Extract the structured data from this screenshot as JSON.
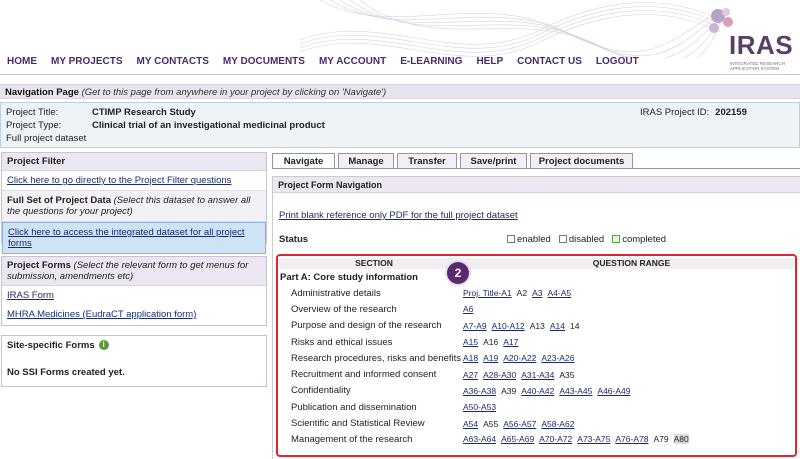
{
  "brand": {
    "name": "IRAS",
    "tagline": "INTEGRATED RESEARCH APPLICATION SYSTEM",
    "color": "#5b3f6b"
  },
  "nav": [
    "HOME",
    "MY PROJECTS",
    "MY CONTACTS",
    "MY DOCUMENTS",
    "MY ACCOUNT",
    "E-LEARNING",
    "HELP",
    "CONTACT US",
    "LOGOUT"
  ],
  "navpage": {
    "title": "Navigation Page",
    "hint": "(Get to this page from anywhere in your project by clicking on 'Navigate')"
  },
  "project": {
    "title_label": "Project Title:",
    "title": "CTIMP Research Study",
    "type_label": "Project Type:",
    "type": "Clinical trial of an investigational medicinal product",
    "dataset": "Full project dataset",
    "id_label": "IRAS Project ID:",
    "id": "202159"
  },
  "filter_panel": {
    "head": "Project Filter",
    "link": "Click here to go directly to the Project Filter questions",
    "full_set_bold": "Full Set of Project Data",
    "full_set_note": "(Select this dataset to answer all the questions for your project)",
    "integrated_link": "Click here to access the integrated dataset for all project forms"
  },
  "forms_panel": {
    "head": "Project Forms",
    "note": "(Select the relevant form to get menus for submission, amendments etc)",
    "iras_form": "IRAS Form",
    "mhra_form": "MHRA Medicines (EudraCT application form)"
  },
  "ssi_panel": {
    "head": "Site-specific Forms",
    "info": "i",
    "empty": "No SSI Forms created yet."
  },
  "tabs": [
    "Navigate",
    "Manage",
    "Transfer",
    "Save/print",
    "Project documents"
  ],
  "right": {
    "head": "Project Form Navigation",
    "print_link": "Print blank reference only PDF for the full project dataset",
    "status_label": "Status",
    "legend": [
      "enabled",
      "disabled",
      "completed"
    ],
    "badge": "2",
    "col_section": "SECTION",
    "col_range": "QUESTION RANGE",
    "part": "Part A: Core study information",
    "sections": [
      {
        "name": "Administrative details",
        "q": [
          [
            "Proj. Title-A1",
            "link"
          ],
          [
            "A2",
            "plain"
          ],
          [
            "A3",
            "link"
          ],
          [
            "A4-A5",
            "link"
          ]
        ]
      },
      {
        "name": "Overview of the research",
        "q": [
          [
            "A6",
            "link"
          ]
        ]
      },
      {
        "name": "Purpose and design of the research",
        "q": [
          [
            "A7-A9",
            "link"
          ],
          [
            "A10-A12",
            "link"
          ],
          [
            "A13",
            "plain"
          ],
          [
            "A14",
            "link"
          ],
          [
            "14",
            "plain"
          ]
        ]
      },
      {
        "name": "Risks and ethical issues",
        "q": [
          [
            "A15",
            "link"
          ],
          [
            "A16",
            "plain"
          ],
          [
            "A17",
            "link"
          ]
        ]
      },
      {
        "name": "Research procedures, risks and benefits",
        "q": [
          [
            "A18",
            "link"
          ],
          [
            "A19",
            "link"
          ],
          [
            "A20-A22",
            "link"
          ],
          [
            "A23-A26",
            "link"
          ]
        ]
      },
      {
        "name": "Recruitment and informed consent",
        "q": [
          [
            "A27",
            "link"
          ],
          [
            "A28-A30",
            "link"
          ],
          [
            "A31-A34",
            "link"
          ],
          [
            "A35",
            "plain"
          ]
        ]
      },
      {
        "name": "Confidentiality",
        "q": [
          [
            "A36-A38",
            "link"
          ],
          [
            "A39",
            "plain"
          ],
          [
            "A40-A42",
            "link"
          ],
          [
            "A43-A45",
            "link"
          ],
          [
            "A46-A49",
            "link"
          ]
        ]
      },
      {
        "name": "Publication and dissemination",
        "q": [
          [
            "A50-A53",
            "link"
          ]
        ]
      },
      {
        "name": "Scientific and Statistical Review",
        "q": [
          [
            "A54",
            "link"
          ],
          [
            "A55",
            "plain"
          ],
          [
            "A56-A57",
            "link"
          ],
          [
            "A58-A62",
            "link"
          ]
        ]
      },
      {
        "name": "Management of the research",
        "q": [
          [
            "A63-A64",
            "link"
          ],
          [
            "A65-A69",
            "link"
          ],
          [
            "A70-A72",
            "link"
          ],
          [
            "A73-A75",
            "link"
          ],
          [
            "A76-A78",
            "link"
          ],
          [
            "A79",
            "plain"
          ],
          [
            "A80",
            "grey"
          ]
        ]
      }
    ]
  },
  "colors": {
    "highlight": "#e0252c",
    "accent": "#4b2a6a",
    "link": "#1a2c6e",
    "panel_blue": "#cfe3f6"
  }
}
